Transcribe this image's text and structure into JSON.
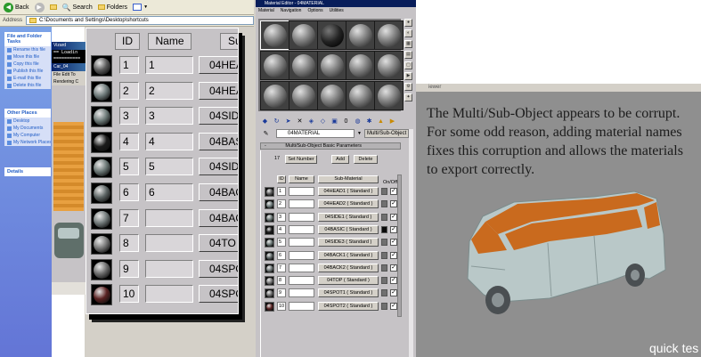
{
  "explorer": {
    "toolbar": {
      "back": "Back",
      "search": "Search",
      "folders": "Folders"
    },
    "address": {
      "label": "Address",
      "path": "C:\\Documents and Settings\\Desktop\\shortcuts"
    },
    "tasks": {
      "header": "File and Folder Tasks",
      "items": [
        "Rename this file",
        "Move this file",
        "Copy this file",
        "Publish this file",
        "E-mail this file",
        "Delete this file"
      ]
    },
    "places": {
      "header": "Other Places",
      "items": [
        "Desktop",
        "My Documents",
        "My Computer",
        "My Network Places"
      ]
    },
    "details": {
      "header": "Details"
    }
  },
  "max_small": {
    "wizard_title": "Vizard",
    "command_lines": [
      "== Loadin",
      "=========="
    ],
    "title": "Car_04",
    "menu": [
      "File",
      "Edit",
      "To"
    ],
    "menu2": [
      "Rendering",
      "C"
    ]
  },
  "sublist": {
    "headers": {
      "id": "ID",
      "name": "Name",
      "sub": "Su"
    },
    "rows": [
      {
        "id": "1",
        "name": "1",
        "sub": "04HEA",
        "color": "#5a5a5a"
      },
      {
        "id": "2",
        "name": "2",
        "sub": "04HEA",
        "color": "#6e7a7a"
      },
      {
        "id": "3",
        "name": "3",
        "sub": "04SIDE",
        "color": "#6d7a78"
      },
      {
        "id": "4",
        "name": "4",
        "sub": "04BAS",
        "color": "#1a1a1a"
      },
      {
        "id": "5",
        "name": "5",
        "sub": "04SIDE",
        "color": "#6b7775"
      },
      {
        "id": "6",
        "name": "6",
        "sub": "04BAC",
        "color": "#5b6363"
      },
      {
        "id": "7",
        "name": "",
        "sub": "04BAC",
        "color": "#707878"
      },
      {
        "id": "8",
        "name": "",
        "sub": "04TO",
        "color": "#777777"
      },
      {
        "id": "9",
        "name": "",
        "sub": "04SPO",
        "color": "#6b6b6b"
      },
      {
        "id": "10",
        "name": "",
        "sub": "04SPO",
        "color": "#5a2222"
      }
    ]
  },
  "material_editor": {
    "title": "Material Editor - 04MATERIAL",
    "menu": [
      "Material",
      "Navigation",
      "Options",
      "Utilities"
    ],
    "material_name": "04MATERIAL",
    "type_button": "Multi/Sub-Object",
    "rollout_title": "Multi/Sub-Object Basic Parameters",
    "count": "17",
    "set_number": "Set Number",
    "add": "Add",
    "delete": "Delete",
    "col_id": "ID",
    "col_name": "Name",
    "col_sub": "Sub-Material",
    "col_onoff": "On/Off",
    "rows": [
      {
        "id": "1",
        "sub": "04HEAD1 ( Standard )",
        "color": "#5a5a5a"
      },
      {
        "id": "2",
        "sub": "04HEAD2 ( Standard )",
        "color": "#6e7a7a"
      },
      {
        "id": "3",
        "sub": "04SIDE1 ( Standard )",
        "color": "#6d7a78"
      },
      {
        "id": "4",
        "sub": "04BASIC ( Standard )",
        "color": "#1a1a1a"
      },
      {
        "id": "5",
        "sub": "04SIDE3 ( Standard )",
        "color": "#6b7775"
      },
      {
        "id": "6",
        "sub": "04BACK1 ( Standard )",
        "color": "#5b6363"
      },
      {
        "id": "7",
        "sub": "04BACK2 ( Standard )",
        "color": "#707878"
      },
      {
        "id": "8",
        "sub": "04TOP ( Standard )",
        "color": "#777777"
      },
      {
        "id": "9",
        "sub": "04SPOT1 ( Standard )",
        "color": "#6b6b6b"
      },
      {
        "id": "10",
        "sub": "04SPOT2 ( Standard )",
        "color": "#5a2222"
      }
    ],
    "checkmark": "✓"
  },
  "viewport": {
    "label": "iewer",
    "note": "The Multi/Sub-Object appears to be corrupt. For some odd reason, adding material names fixes this corruption and allows the materials to export correctly.",
    "footer": "quick tes"
  },
  "colors": {
    "orange": "#c96a1e",
    "van_body": "#b9c8c8"
  }
}
